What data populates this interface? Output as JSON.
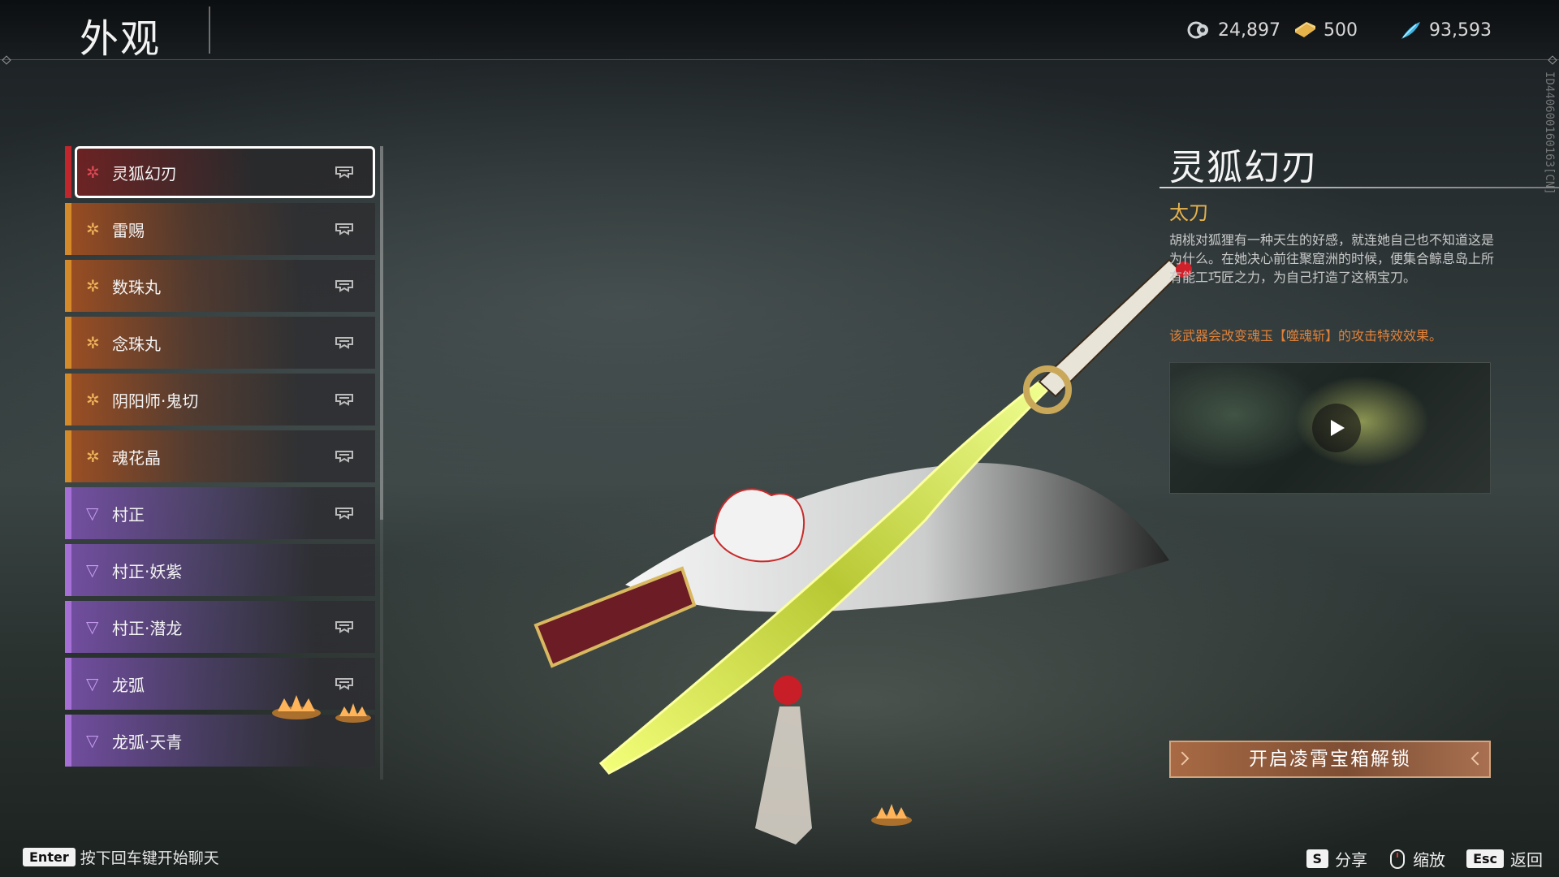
{
  "header": {
    "title": "外观",
    "currencies": [
      {
        "icon": "spirit-orb-icon",
        "value": "24,897"
      },
      {
        "icon": "gold-ingot-icon",
        "value": "500"
      },
      {
        "icon": "feather-icon",
        "value": "93,593"
      }
    ]
  },
  "list": {
    "items": [
      {
        "name": "灵狐幻刃",
        "rarity": "red",
        "owned_icon": true,
        "selected": true
      },
      {
        "name": "雷赐",
        "rarity": "orange",
        "owned_icon": true
      },
      {
        "name": "数珠丸",
        "rarity": "orange",
        "owned_icon": true
      },
      {
        "name": "念珠丸",
        "rarity": "orange",
        "owned_icon": true
      },
      {
        "name": "阴阳师·鬼切",
        "rarity": "orange",
        "owned_icon": true
      },
      {
        "name": "魂花晶",
        "rarity": "orange",
        "owned_icon": true
      },
      {
        "name": "村正",
        "rarity": "purple",
        "owned_icon": true
      },
      {
        "name": "村正·妖紫",
        "rarity": "purple",
        "owned_icon": false
      },
      {
        "name": "村正·潜龙",
        "rarity": "purple",
        "owned_icon": true
      },
      {
        "name": "龙弧",
        "rarity": "purple",
        "owned_icon": true
      },
      {
        "name": "龙弧·天青",
        "rarity": "purple",
        "owned_icon": false
      }
    ]
  },
  "detail": {
    "title": "灵狐幻刃",
    "type": "太刀",
    "description": "胡桃对狐狸有一种天生的好感，就连她自己也不知道这是为什么。在她决心前往聚窟洲的时候，便集合鲸息岛上所有能工巧匠之力，为自己打造了这柄宝刀。",
    "note": "该武器会改变魂玉【噬魂斩】的攻击特效效果。",
    "unlock_button": "开启凌霄宝箱解锁"
  },
  "build_id": "ID4406001601​63[CN]",
  "footer": {
    "chat_key": "Enter",
    "chat_hint": "按下回车键开始聊天",
    "share_key": "S",
    "share_label": "分享",
    "zoom_label": "缩放",
    "back_key": "Esc",
    "back_label": "返回"
  },
  "colors": {
    "rarity_red": "#c0262c",
    "rarity_orange": "#d58a2a",
    "rarity_purple": "#a56fd6",
    "accent_gold": "#e5b24d",
    "note_orange": "#e0823a"
  }
}
